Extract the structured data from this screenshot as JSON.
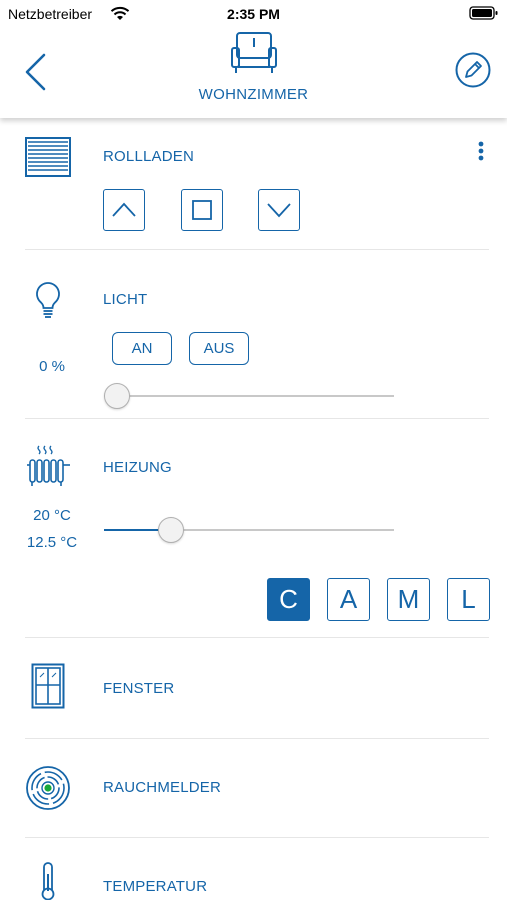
{
  "status_bar": {
    "carrier": "Netzbetreiber",
    "time": "2:35 PM"
  },
  "header": {
    "title": "WOHNZIMMER",
    "room_icon": "armchair-icon",
    "back_icon": "chevron-left-icon",
    "edit_icon": "pencil-icon"
  },
  "colors": {
    "accent": "#1565a8",
    "divider": "#e6e6e6",
    "track": "#c8c8c8"
  },
  "rollladen": {
    "label": "ROLLLADEN",
    "icon": "blinds-icon",
    "menu_icon": "more-vertical-icon",
    "buttons": [
      "up",
      "stop",
      "down"
    ]
  },
  "licht": {
    "label": "LICHT",
    "icon": "lightbulb-icon",
    "value": "0 %",
    "on_label": "AN",
    "off_label": "AUS",
    "dimmer_level": 0
  },
  "heizung": {
    "label": "HEIZUNG",
    "icon": "radiator-icon",
    "target_temp": "20 °C",
    "current_temp": "12.5 °C",
    "slider_level": 0.23,
    "modes": [
      {
        "label": "C",
        "active": true
      },
      {
        "label": "A",
        "active": false
      },
      {
        "label": "M",
        "active": false
      },
      {
        "label": "L",
        "active": false
      }
    ]
  },
  "fenster": {
    "label": "FENSTER",
    "icon": "window-icon"
  },
  "rauchmelder": {
    "label": "RAUCHMELDER",
    "icon": "smoke-detector-icon"
  },
  "temperatur": {
    "label": "TEMPERATUR",
    "icon": "thermometer-icon"
  }
}
